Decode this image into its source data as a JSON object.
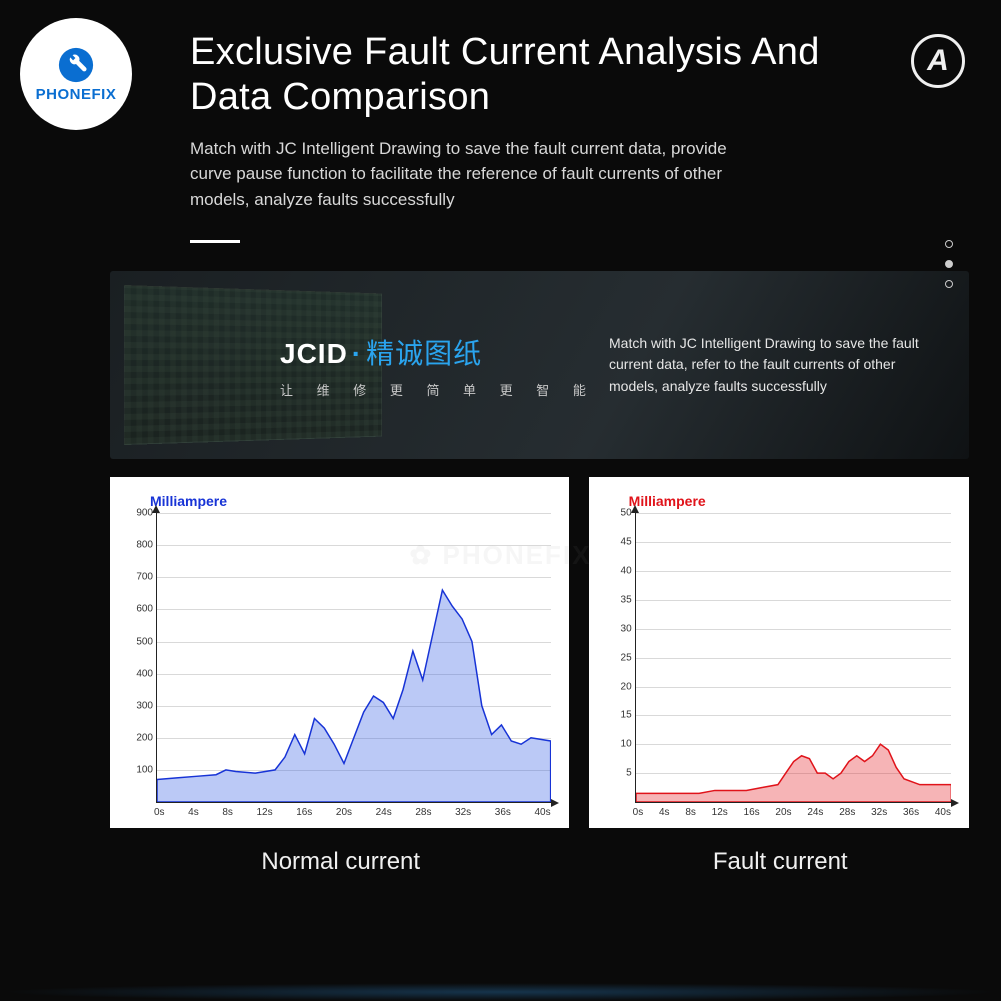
{
  "logo_text": "PHONEFIX",
  "badge_letter": "A",
  "hero": {
    "title": "Exclusive Fault Current Analysis And Data Comparison",
    "subtitle": "Match with JC Intelligent Drawing to save the fault current data, provide curve pause function to facilitate the reference of fault currents of other models, analyze faults successfully"
  },
  "jcid": {
    "brand": "JCID",
    "dot": "·",
    "zh": "精诚图纸",
    "tagline": "让 维 修 更 简 单 更 智 能",
    "desc": "Match with JC Intelligent Drawing to save the fault current data, refer to the fault currents of other models, analyze faults successfully"
  },
  "captions": {
    "normal": "Normal current",
    "fault": "Fault current"
  },
  "watermark_center": "✿ PHONEFIX",
  "chart_data": [
    {
      "type": "area",
      "title": "Normal current",
      "ylabel": "Milliampere",
      "ylim": [
        0,
        900
      ],
      "y_ticks": [
        100,
        200,
        300,
        400,
        500,
        600,
        700,
        800,
        900
      ],
      "x_ticks": [
        "0s",
        "4s",
        "8s",
        "12s",
        "16s",
        "20s",
        "24s",
        "28s",
        "32s",
        "36s",
        "40s"
      ],
      "x": [
        0,
        2,
        4,
        6,
        7,
        8,
        10,
        12,
        13,
        14,
        15,
        16,
        17,
        18,
        19,
        20,
        21,
        22,
        23,
        24,
        25,
        26,
        27,
        28,
        29,
        30,
        31,
        32,
        33,
        34,
        35,
        36,
        37,
        38,
        40
      ],
      "values": [
        70,
        75,
        80,
        85,
        100,
        95,
        90,
        100,
        140,
        210,
        150,
        260,
        230,
        180,
        120,
        200,
        280,
        330,
        310,
        260,
        350,
        470,
        380,
        520,
        660,
        610,
        570,
        500,
        300,
        210,
        240,
        190,
        180,
        200,
        190
      ],
      "color": "#1733d6",
      "fill": "rgba(60,100,230,0.35)"
    },
    {
      "type": "area",
      "title": "Fault current",
      "ylabel": "Milliampere",
      "ylim": [
        0,
        50
      ],
      "y_ticks": [
        5,
        10,
        15,
        20,
        25,
        30,
        35,
        40,
        45,
        50
      ],
      "x_ticks": [
        "0s",
        "4s",
        "8s",
        "12s",
        "16s",
        "20s",
        "24s",
        "28s",
        "32s",
        "36s",
        "40s"
      ],
      "x": [
        0,
        4,
        8,
        10,
        12,
        14,
        16,
        18,
        19,
        20,
        21,
        22,
        23,
        24,
        25,
        26,
        27,
        28,
        29,
        30,
        31,
        32,
        33,
        34,
        36,
        38,
        40
      ],
      "values": [
        1.5,
        1.5,
        1.5,
        2,
        2,
        2,
        2.5,
        3,
        5,
        7,
        8,
        7.5,
        5,
        5,
        4,
        5,
        7,
        8,
        7,
        8,
        10,
        9,
        6,
        4,
        3,
        3,
        3
      ],
      "color": "#e0131a",
      "fill": "rgba(230,40,45,0.35)"
    }
  ]
}
